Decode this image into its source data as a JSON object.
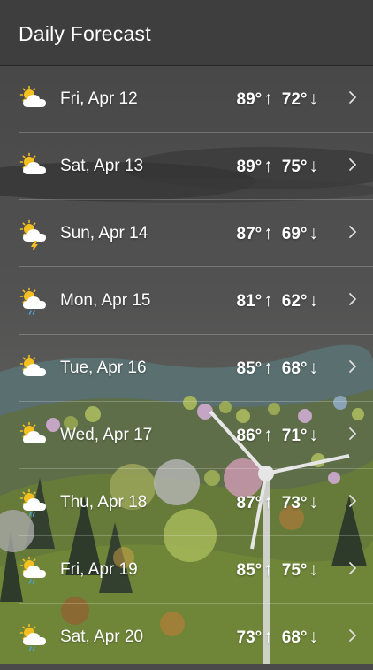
{
  "header": {
    "title": "Daily Forecast"
  },
  "arrows": {
    "up": "↑",
    "down": "↓"
  },
  "days": [
    {
      "date": "Fri, Apr 12",
      "high": "89°",
      "low": "72°",
      "icon": "partly-sunny-icon"
    },
    {
      "date": "Sat, Apr 13",
      "high": "89°",
      "low": "75°",
      "icon": "partly-sunny-icon"
    },
    {
      "date": "Sun, Apr 14",
      "high": "87°",
      "low": "69°",
      "icon": "thunderstorm-icon"
    },
    {
      "date": "Mon, Apr 15",
      "high": "81°",
      "low": "62°",
      "icon": "sun-cloud-rain-icon"
    },
    {
      "date": "Tue, Apr 16",
      "high": "85°",
      "low": "68°",
      "icon": "partly-sunny-icon"
    },
    {
      "date": "Wed, Apr 17",
      "high": "86°",
      "low": "71°",
      "icon": "partly-sunny-icon"
    },
    {
      "date": "Thu, Apr 18",
      "high": "87°",
      "low": "73°",
      "icon": "sun-cloud-rain-icon"
    },
    {
      "date": "Fri, Apr 19",
      "high": "85°",
      "low": "75°",
      "icon": "sun-cloud-rain-icon"
    },
    {
      "date": "Sat, Apr 20",
      "high": "73°",
      "low": "68°",
      "icon": "sun-cloud-rain-icon"
    }
  ]
}
